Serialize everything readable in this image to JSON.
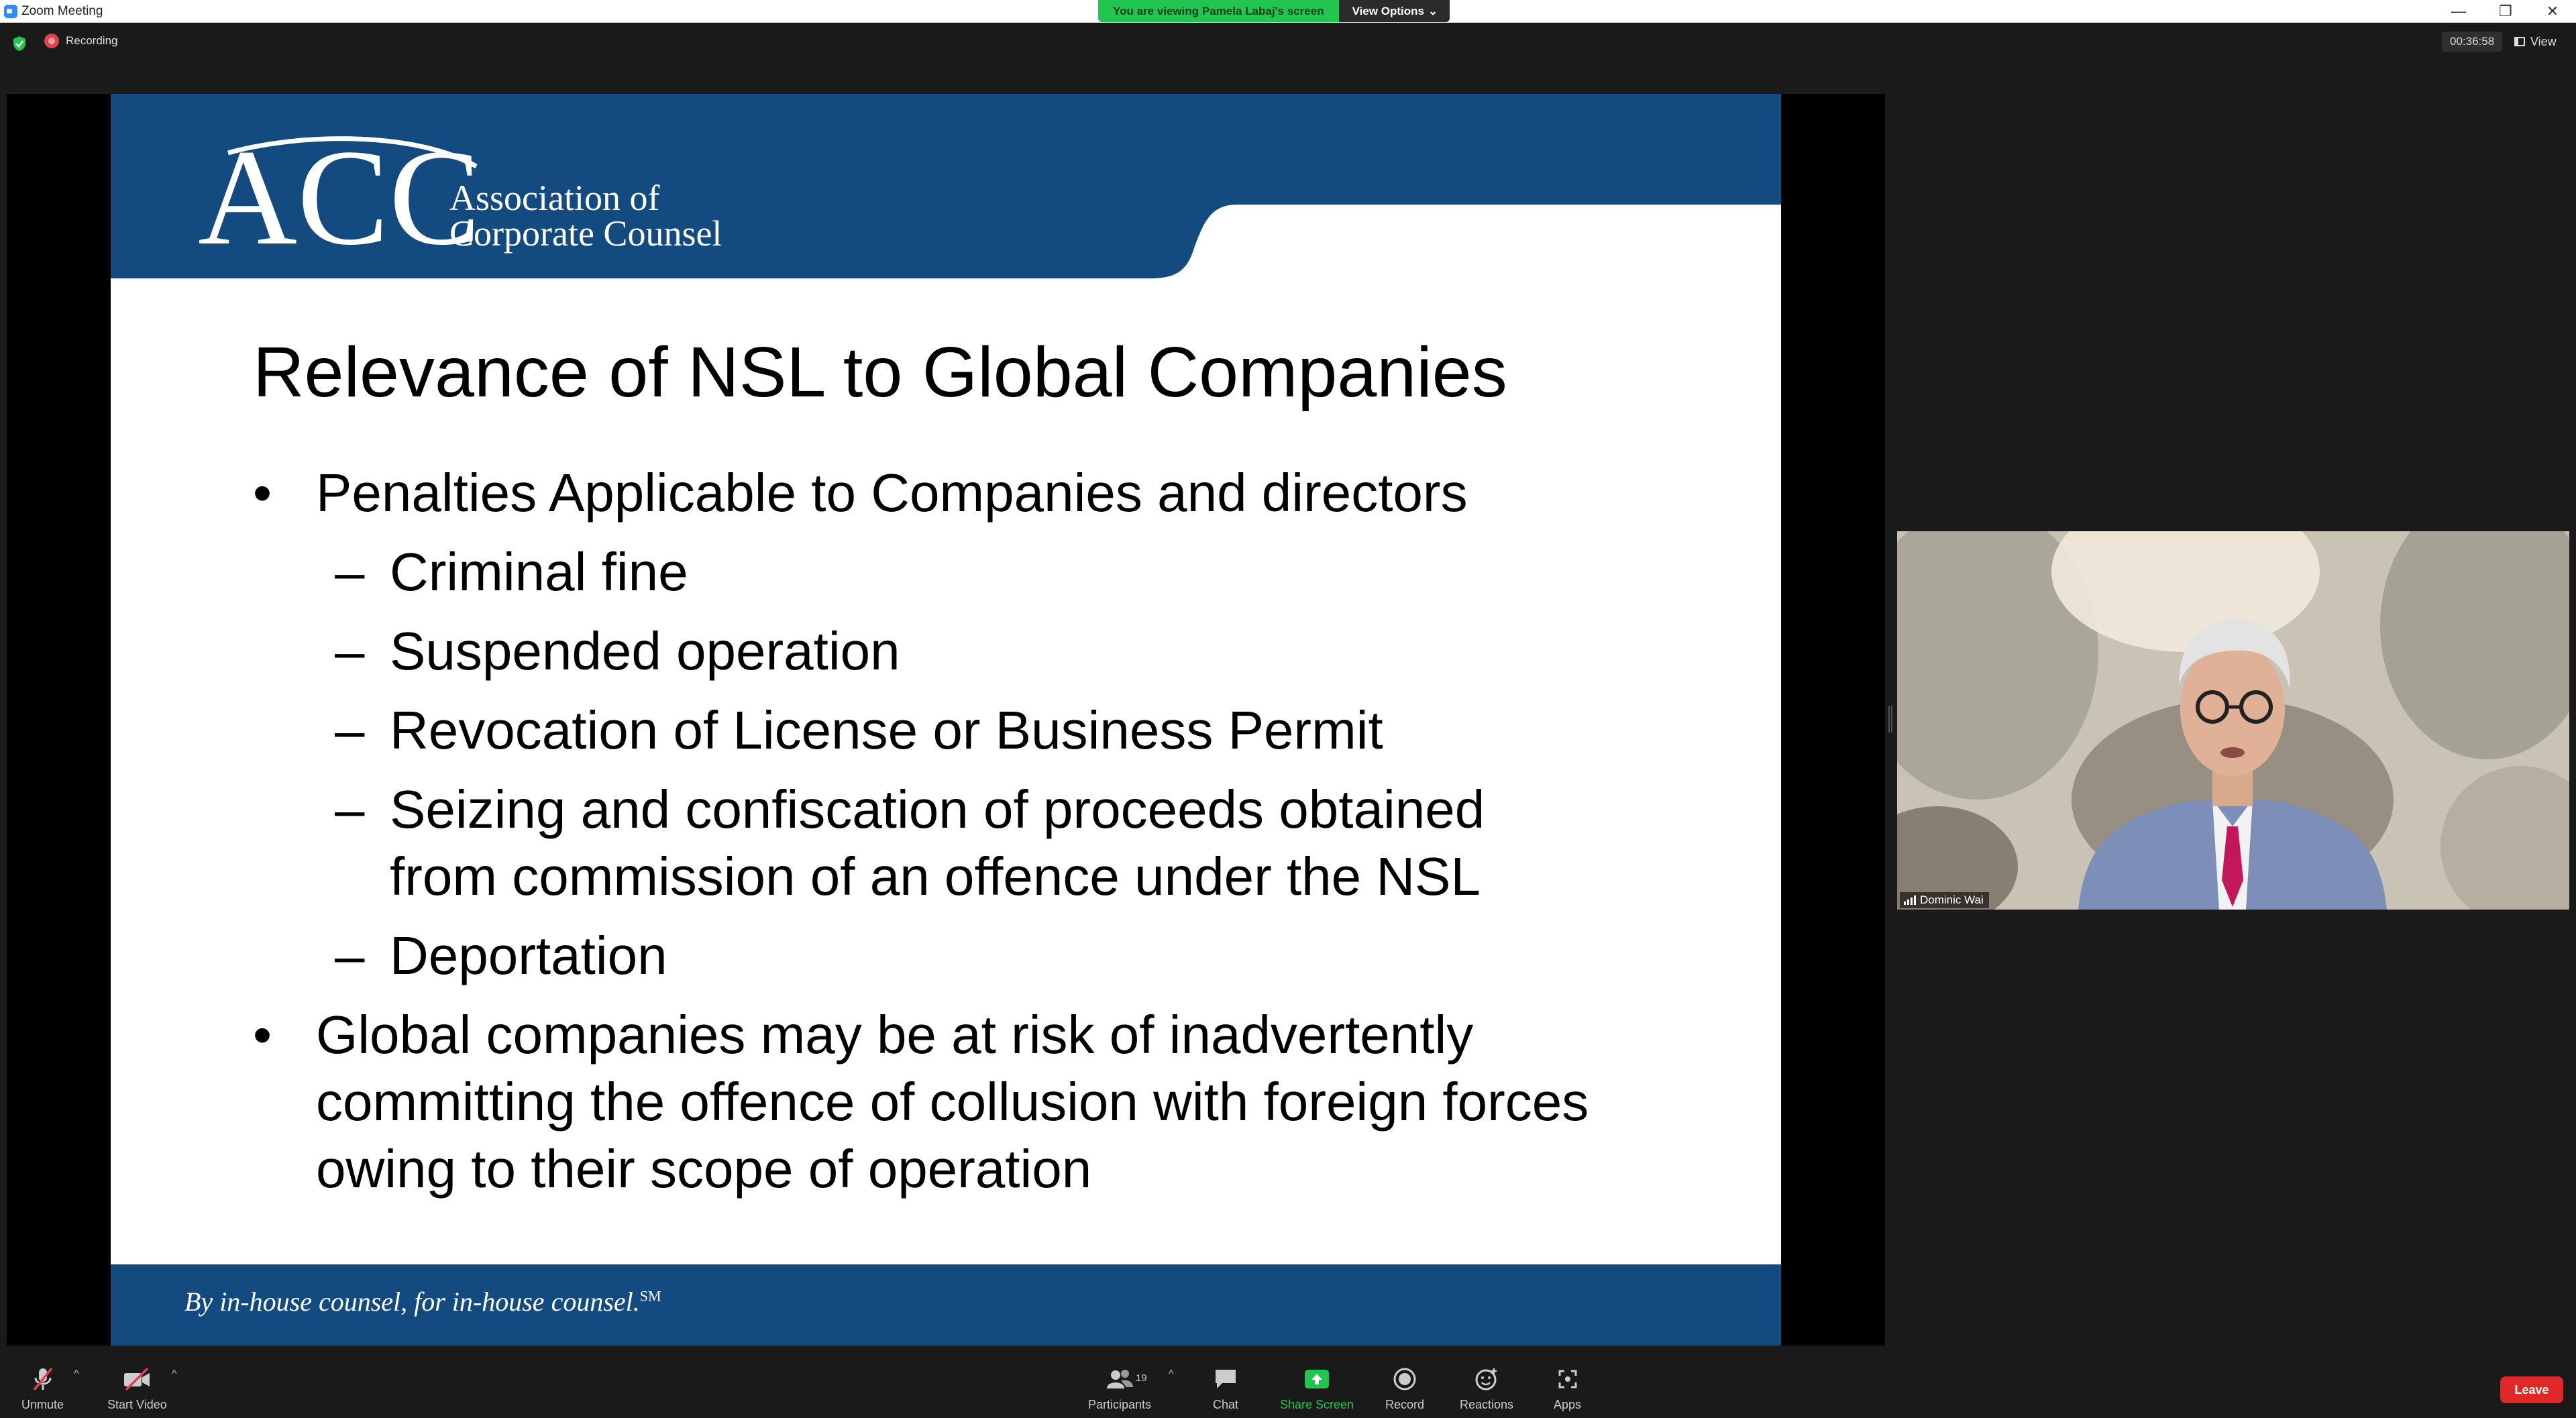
{
  "window": {
    "title": "Zoom Meeting",
    "controls": [
      "—",
      "❐",
      "✕"
    ]
  },
  "banner": {
    "viewing": "You are viewing Pamela Labaj's screen",
    "view_options": "View Options",
    "chevron": "⌄"
  },
  "status": {
    "recording": "Recording",
    "timer": "00:36:58",
    "view": "View"
  },
  "slide": {
    "logo_acc": "ACC",
    "logo_line1": "Association of",
    "logo_line2": "Corporate Counsel",
    "title": "Relevance of NSL to Global Companies",
    "bullet1": "Penalties Applicable to Companies and directors",
    "sub1": "Criminal fine",
    "sub2": "Suspended operation",
    "sub3": "Revocation of License or Business Permit",
    "sub4_line1": "Seizing and confiscation of proceeds obtained",
    "sub4_line2": "from commission of an offence under the NSL",
    "sub5": "Deportation",
    "bullet2_line1": "Global companies may be at risk of inadvertently",
    "bullet2_line2": "committing the offence of collusion with foreign forces",
    "bullet2_line3": "owing to their scope of operation",
    "dash": "–",
    "tagline": "By in-house counsel, for in-house counsel.",
    "tagline_mark": "SM",
    "colors": {
      "header_blue": "#134b80",
      "footer_blue": "#134b80"
    }
  },
  "video": {
    "participant_name": "Dominic Wai"
  },
  "toolbar": {
    "unmute": "Unmute",
    "start_video": "Start Video",
    "participants": "Participants",
    "participant_count": "19",
    "chat": "Chat",
    "share_screen": "Share Screen",
    "record": "Record",
    "reactions": "Reactions",
    "apps": "Apps",
    "leave": "Leave",
    "caret": "^"
  }
}
